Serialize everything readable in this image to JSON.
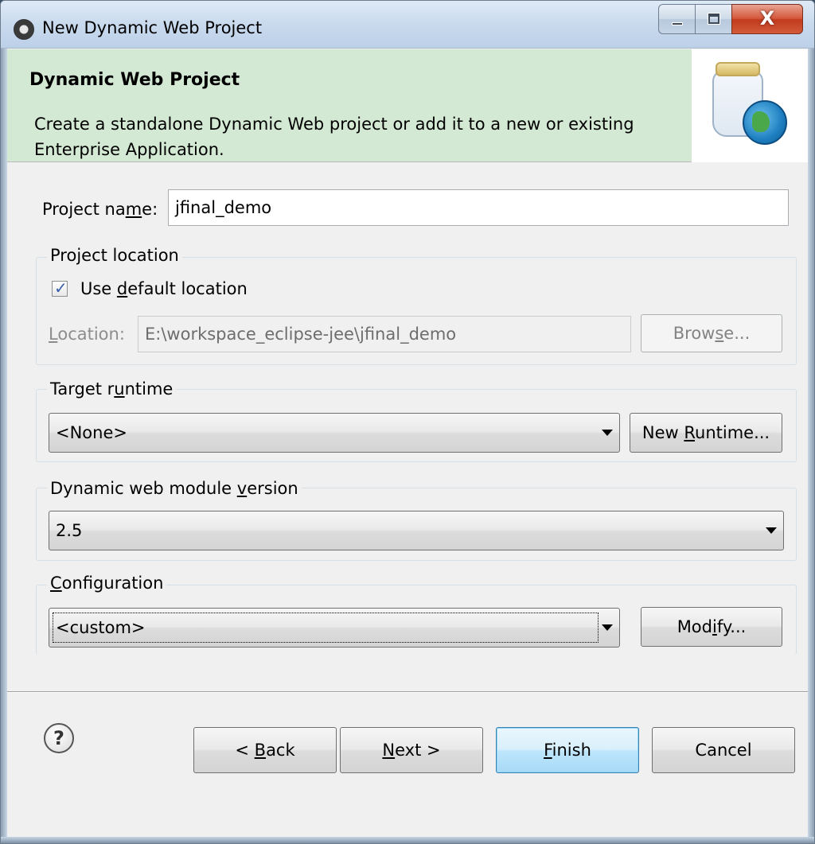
{
  "window": {
    "title": "New Dynamic Web Project"
  },
  "banner": {
    "title": "Dynamic Web Project",
    "description": "Create a standalone Dynamic Web project or add it to a new or existing Enterprise Application.",
    "icon": "jar-globe-icon"
  },
  "project_name": {
    "label_pre": "Project na",
    "label_ul": "m",
    "label_post": "e:",
    "value": "jfinal_demo"
  },
  "location_group": {
    "title": "Project location",
    "use_default": {
      "pre": "Use ",
      "ul": "d",
      "post": "efault location",
      "checked": true
    },
    "location_label": {
      "ul": "L",
      "post": "ocation:"
    },
    "location_value": "E:\\workspace_eclipse-jee\\jfinal_demo",
    "browse": {
      "pre": "Brow",
      "ul": "s",
      "post": "e..."
    }
  },
  "runtime_group": {
    "title_pre": "Target r",
    "title_ul": "u",
    "title_post": "ntime",
    "selected": "<None>",
    "new_runtime": {
      "pre": "New ",
      "ul": "R",
      "post": "untime..."
    }
  },
  "module_group": {
    "title_pre": "Dynamic web module ",
    "title_ul": "v",
    "title_post": "ersion",
    "selected": "2.5"
  },
  "config_group": {
    "title_ul": "C",
    "title_post": "onfiguration",
    "selected": "<custom>",
    "modify": {
      "pre": "Mod",
      "ul": "i",
      "post": "fy..."
    }
  },
  "footer": {
    "back": {
      "pre": "< ",
      "ul": "B",
      "post": "ack"
    },
    "next": {
      "ul": "N",
      "post": "ext >"
    },
    "finish": {
      "ul": "F",
      "post": "inish"
    },
    "cancel": "Cancel"
  },
  "colors": {
    "banner_bg": "#d4e9d4",
    "dialog_bg": "#f0f0f0",
    "close_red": "#c13b1f"
  }
}
